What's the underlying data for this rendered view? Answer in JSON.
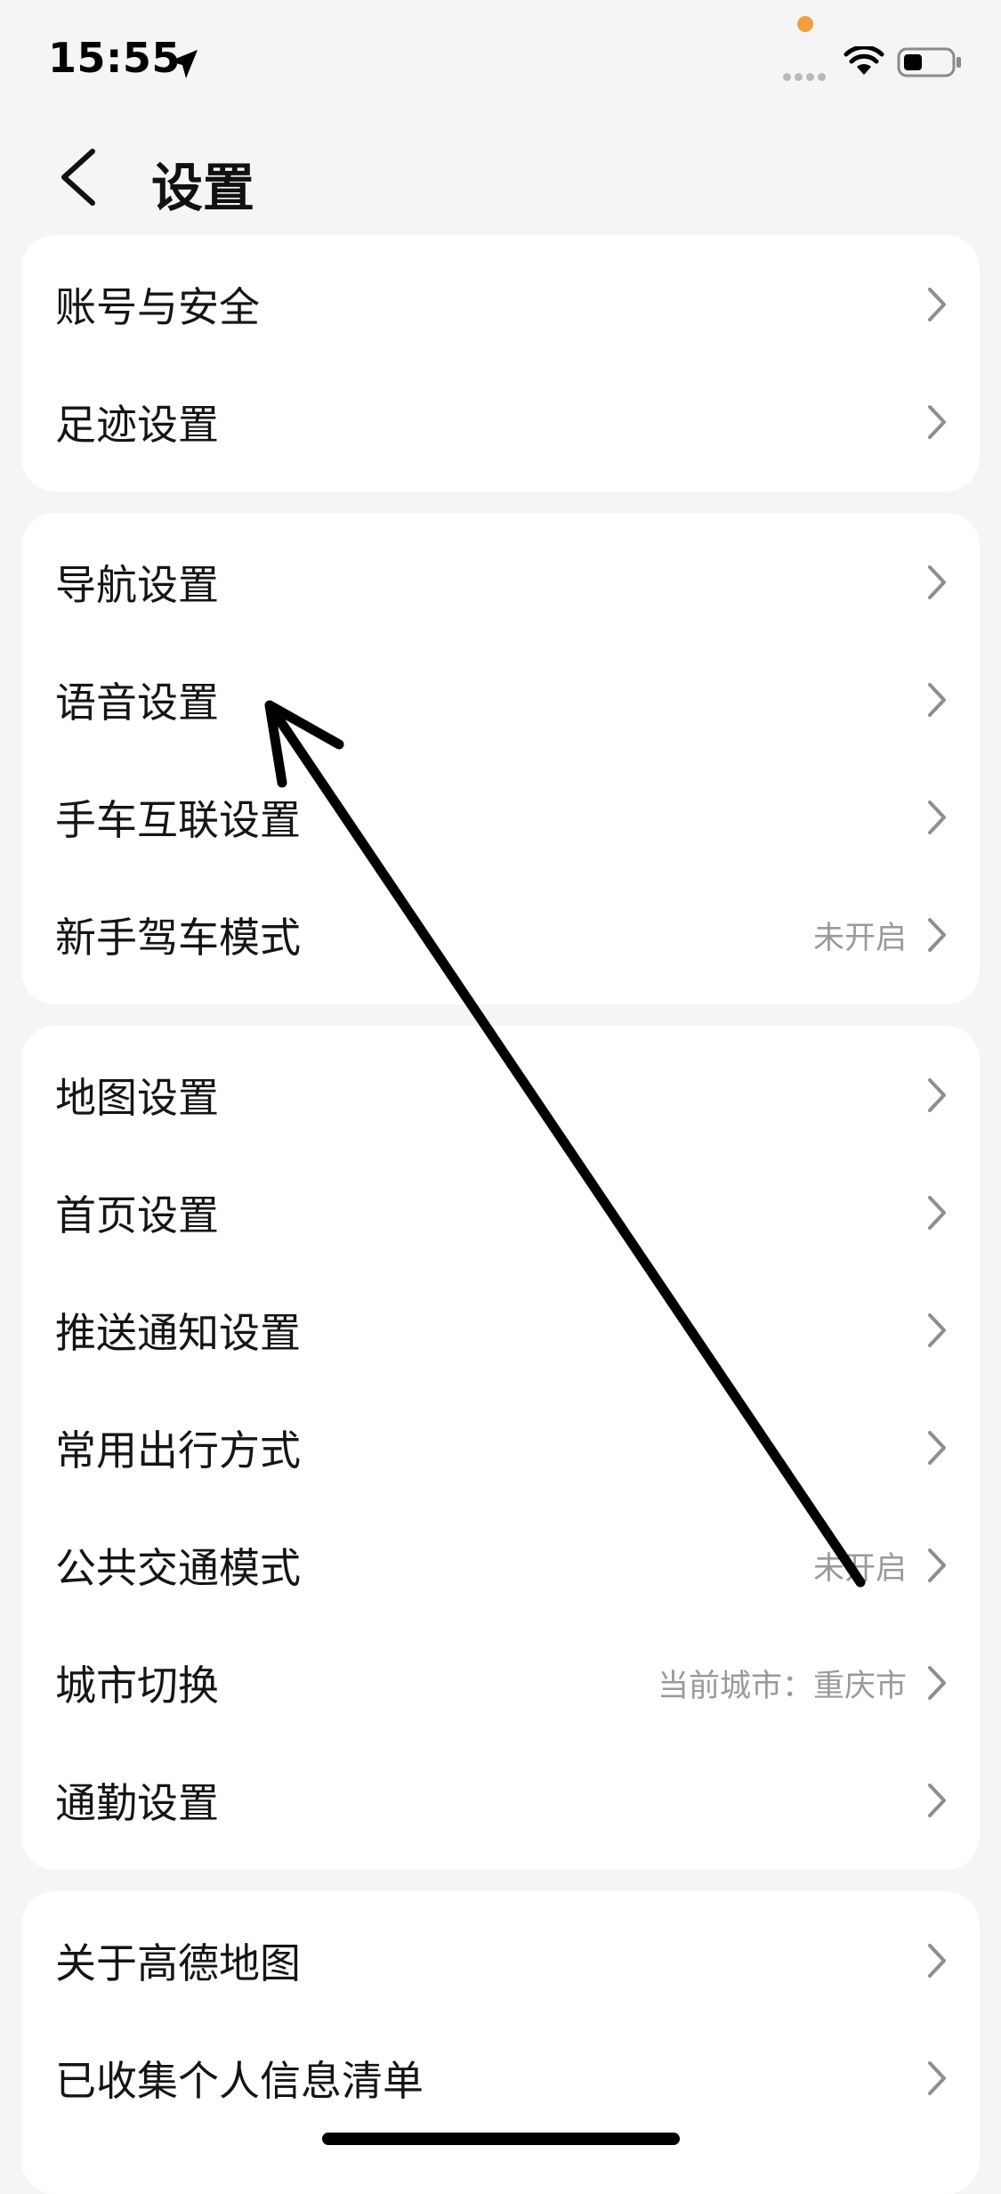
{
  "status_bar": {
    "time": "15:55"
  },
  "header": {
    "title": "设置"
  },
  "groups": [
    {
      "items": [
        {
          "label": "账号与安全",
          "value": ""
        },
        {
          "label": "足迹设置",
          "value": ""
        }
      ]
    },
    {
      "items": [
        {
          "label": "导航设置",
          "value": ""
        },
        {
          "label": "语音设置",
          "value": ""
        },
        {
          "label": "手车互联设置",
          "value": ""
        },
        {
          "label": "新手驾车模式",
          "value": "未开启"
        }
      ]
    },
    {
      "items": [
        {
          "label": "地图设置",
          "value": ""
        },
        {
          "label": "首页设置",
          "value": ""
        },
        {
          "label": "推送通知设置",
          "value": ""
        },
        {
          "label": "常用出行方式",
          "value": ""
        },
        {
          "label": "公共交通模式",
          "value": "未开启"
        },
        {
          "label": "城市切换",
          "value": "当前城市：重庆市"
        },
        {
          "label": "通勤设置",
          "value": ""
        }
      ]
    },
    {
      "items": [
        {
          "label": "关于高德地图",
          "value": ""
        },
        {
          "label": "已收集个人信息清单",
          "value": ""
        }
      ]
    }
  ],
  "icons": {
    "back": "chevron-left-icon",
    "row_chevron": "chevron-right-icon",
    "location": "location-arrow-icon",
    "wifi": "wifi-icon",
    "battery": "battery-icon"
  },
  "colors": {
    "background": "#f5f5f5",
    "card": "#ffffff",
    "text": "#151515",
    "secondary_text": "#9a9a9a",
    "chevron": "#8e8e8e",
    "recording_dot": "#f0a040"
  }
}
